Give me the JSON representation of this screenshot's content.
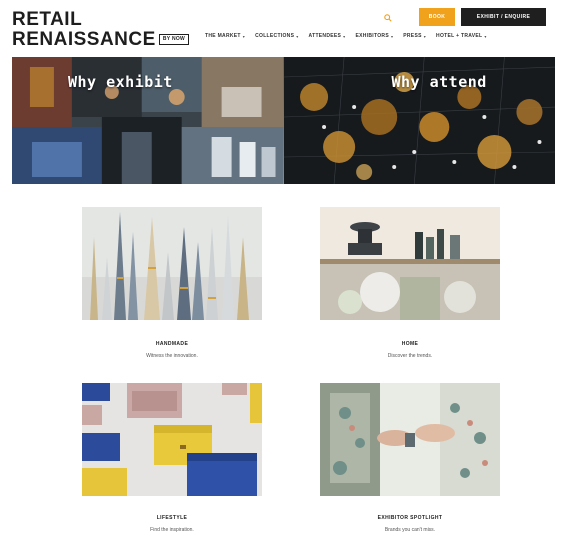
{
  "logo": {
    "line1": "RETAIL",
    "line2": "RENAISSANCE",
    "tag": "BY NOW"
  },
  "header": {
    "search_icon": "search-icon",
    "book_label": "BOOK",
    "exhibit_label": "EXHIBIT / ENQUIRE"
  },
  "nav": {
    "items": [
      {
        "label": "THE MARKET"
      },
      {
        "label": "COLLECTIONS"
      },
      {
        "label": "ATTENDEES"
      },
      {
        "label": "EXHIBITORS"
      },
      {
        "label": "PRESS"
      },
      {
        "label": "HOTEL + TRAVEL"
      }
    ]
  },
  "hero": {
    "left_title": "Why exhibit",
    "right_title": "Why attend"
  },
  "cards": [
    {
      "title": "HANDMADE",
      "subtitle": "Witness the innovation."
    },
    {
      "title": "HOME",
      "subtitle": "Discover the trends."
    },
    {
      "title": "LIFESTYLE",
      "subtitle": "Find the inspiration."
    },
    {
      "title": "EXHIBITOR SPOTLIGHT",
      "subtitle": "Brands you can't miss."
    }
  ],
  "colors": {
    "accent": "#f0a21c",
    "dark": "#1f1f1f"
  }
}
